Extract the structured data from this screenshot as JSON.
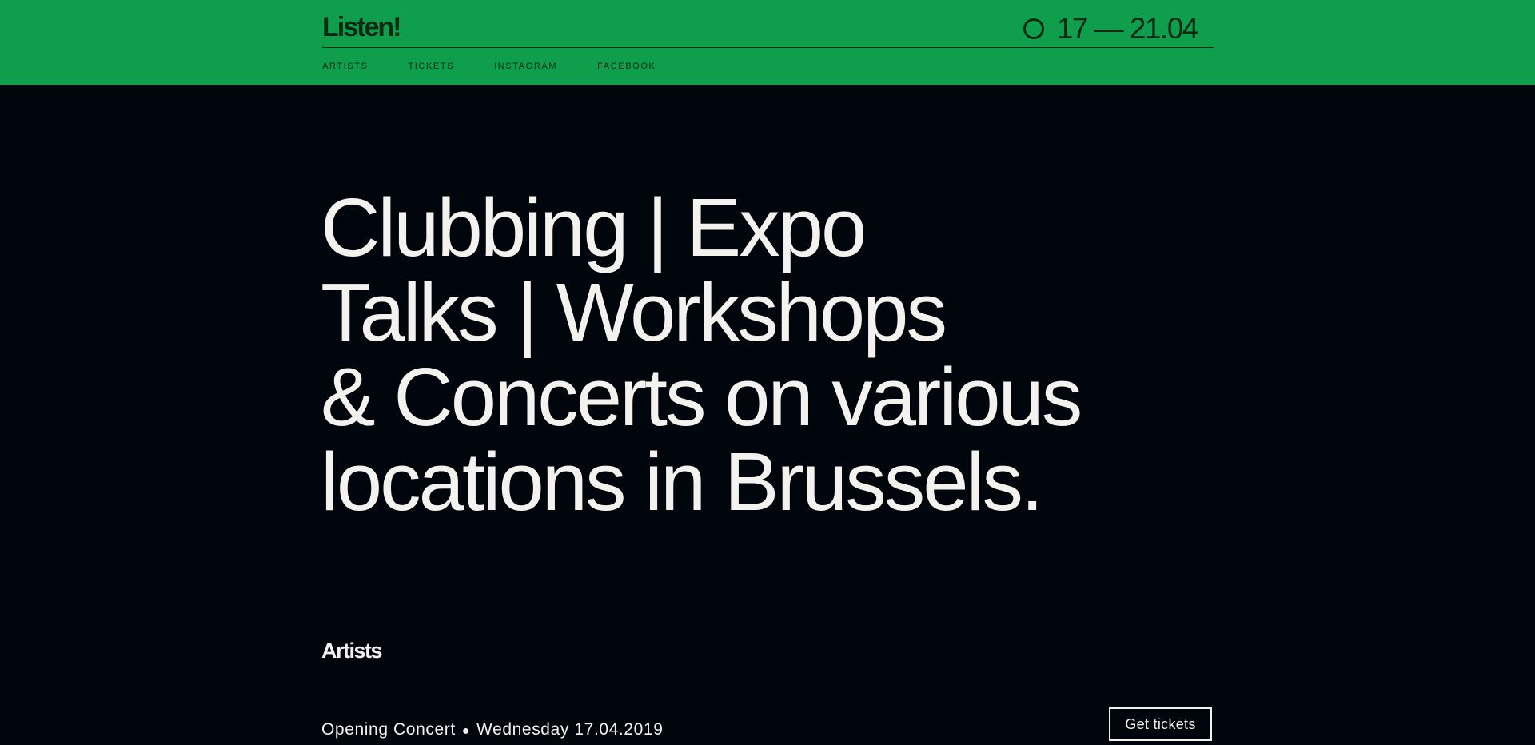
{
  "header": {
    "logo": "Listen!",
    "dates": "17 — 21.04",
    "nav": [
      {
        "label": "ARTISTS"
      },
      {
        "label": "TICKETS"
      },
      {
        "label": "INSTAGRAM"
      },
      {
        "label": "FACEBOOK"
      }
    ]
  },
  "hero": {
    "lines": [
      "Clubbing | Expo",
      "Talks | Workshops",
      "& Concerts on various",
      "locations in Brussels."
    ]
  },
  "artists": {
    "title": "Artists",
    "event": {
      "name": "Opening Concert",
      "separator": "●",
      "date": "Wednesday 17.04.2019",
      "button": "Get tickets"
    }
  },
  "colors": {
    "header_bg": "#0e9e4c",
    "page_bg": "#01060d",
    "text_light": "#f3f2ee",
    "text_dark": "#062a14"
  }
}
